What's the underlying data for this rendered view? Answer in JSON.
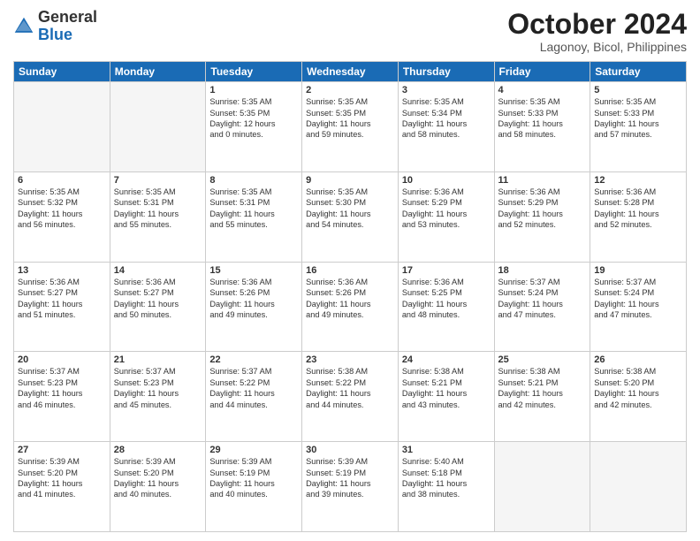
{
  "header": {
    "logo_general": "General",
    "logo_blue": "Blue",
    "month_title": "October 2024",
    "location": "Lagonoy, Bicol, Philippines"
  },
  "weekdays": [
    "Sunday",
    "Monday",
    "Tuesday",
    "Wednesday",
    "Thursday",
    "Friday",
    "Saturday"
  ],
  "weeks": [
    [
      {
        "day": "",
        "info": ""
      },
      {
        "day": "",
        "info": ""
      },
      {
        "day": "1",
        "info": "Sunrise: 5:35 AM\nSunset: 5:35 PM\nDaylight: 12 hours\nand 0 minutes."
      },
      {
        "day": "2",
        "info": "Sunrise: 5:35 AM\nSunset: 5:35 PM\nDaylight: 11 hours\nand 59 minutes."
      },
      {
        "day": "3",
        "info": "Sunrise: 5:35 AM\nSunset: 5:34 PM\nDaylight: 11 hours\nand 58 minutes."
      },
      {
        "day": "4",
        "info": "Sunrise: 5:35 AM\nSunset: 5:33 PM\nDaylight: 11 hours\nand 58 minutes."
      },
      {
        "day": "5",
        "info": "Sunrise: 5:35 AM\nSunset: 5:33 PM\nDaylight: 11 hours\nand 57 minutes."
      }
    ],
    [
      {
        "day": "6",
        "info": "Sunrise: 5:35 AM\nSunset: 5:32 PM\nDaylight: 11 hours\nand 56 minutes."
      },
      {
        "day": "7",
        "info": "Sunrise: 5:35 AM\nSunset: 5:31 PM\nDaylight: 11 hours\nand 55 minutes."
      },
      {
        "day": "8",
        "info": "Sunrise: 5:35 AM\nSunset: 5:31 PM\nDaylight: 11 hours\nand 55 minutes."
      },
      {
        "day": "9",
        "info": "Sunrise: 5:35 AM\nSunset: 5:30 PM\nDaylight: 11 hours\nand 54 minutes."
      },
      {
        "day": "10",
        "info": "Sunrise: 5:36 AM\nSunset: 5:29 PM\nDaylight: 11 hours\nand 53 minutes."
      },
      {
        "day": "11",
        "info": "Sunrise: 5:36 AM\nSunset: 5:29 PM\nDaylight: 11 hours\nand 52 minutes."
      },
      {
        "day": "12",
        "info": "Sunrise: 5:36 AM\nSunset: 5:28 PM\nDaylight: 11 hours\nand 52 minutes."
      }
    ],
    [
      {
        "day": "13",
        "info": "Sunrise: 5:36 AM\nSunset: 5:27 PM\nDaylight: 11 hours\nand 51 minutes."
      },
      {
        "day": "14",
        "info": "Sunrise: 5:36 AM\nSunset: 5:27 PM\nDaylight: 11 hours\nand 50 minutes."
      },
      {
        "day": "15",
        "info": "Sunrise: 5:36 AM\nSunset: 5:26 PM\nDaylight: 11 hours\nand 49 minutes."
      },
      {
        "day": "16",
        "info": "Sunrise: 5:36 AM\nSunset: 5:26 PM\nDaylight: 11 hours\nand 49 minutes."
      },
      {
        "day": "17",
        "info": "Sunrise: 5:36 AM\nSunset: 5:25 PM\nDaylight: 11 hours\nand 48 minutes."
      },
      {
        "day": "18",
        "info": "Sunrise: 5:37 AM\nSunset: 5:24 PM\nDaylight: 11 hours\nand 47 minutes."
      },
      {
        "day": "19",
        "info": "Sunrise: 5:37 AM\nSunset: 5:24 PM\nDaylight: 11 hours\nand 47 minutes."
      }
    ],
    [
      {
        "day": "20",
        "info": "Sunrise: 5:37 AM\nSunset: 5:23 PM\nDaylight: 11 hours\nand 46 minutes."
      },
      {
        "day": "21",
        "info": "Sunrise: 5:37 AM\nSunset: 5:23 PM\nDaylight: 11 hours\nand 45 minutes."
      },
      {
        "day": "22",
        "info": "Sunrise: 5:37 AM\nSunset: 5:22 PM\nDaylight: 11 hours\nand 44 minutes."
      },
      {
        "day": "23",
        "info": "Sunrise: 5:38 AM\nSunset: 5:22 PM\nDaylight: 11 hours\nand 44 minutes."
      },
      {
        "day": "24",
        "info": "Sunrise: 5:38 AM\nSunset: 5:21 PM\nDaylight: 11 hours\nand 43 minutes."
      },
      {
        "day": "25",
        "info": "Sunrise: 5:38 AM\nSunset: 5:21 PM\nDaylight: 11 hours\nand 42 minutes."
      },
      {
        "day": "26",
        "info": "Sunrise: 5:38 AM\nSunset: 5:20 PM\nDaylight: 11 hours\nand 42 minutes."
      }
    ],
    [
      {
        "day": "27",
        "info": "Sunrise: 5:39 AM\nSunset: 5:20 PM\nDaylight: 11 hours\nand 41 minutes."
      },
      {
        "day": "28",
        "info": "Sunrise: 5:39 AM\nSunset: 5:20 PM\nDaylight: 11 hours\nand 40 minutes."
      },
      {
        "day": "29",
        "info": "Sunrise: 5:39 AM\nSunset: 5:19 PM\nDaylight: 11 hours\nand 40 minutes."
      },
      {
        "day": "30",
        "info": "Sunrise: 5:39 AM\nSunset: 5:19 PM\nDaylight: 11 hours\nand 39 minutes."
      },
      {
        "day": "31",
        "info": "Sunrise: 5:40 AM\nSunset: 5:18 PM\nDaylight: 11 hours\nand 38 minutes."
      },
      {
        "day": "",
        "info": ""
      },
      {
        "day": "",
        "info": ""
      }
    ]
  ]
}
